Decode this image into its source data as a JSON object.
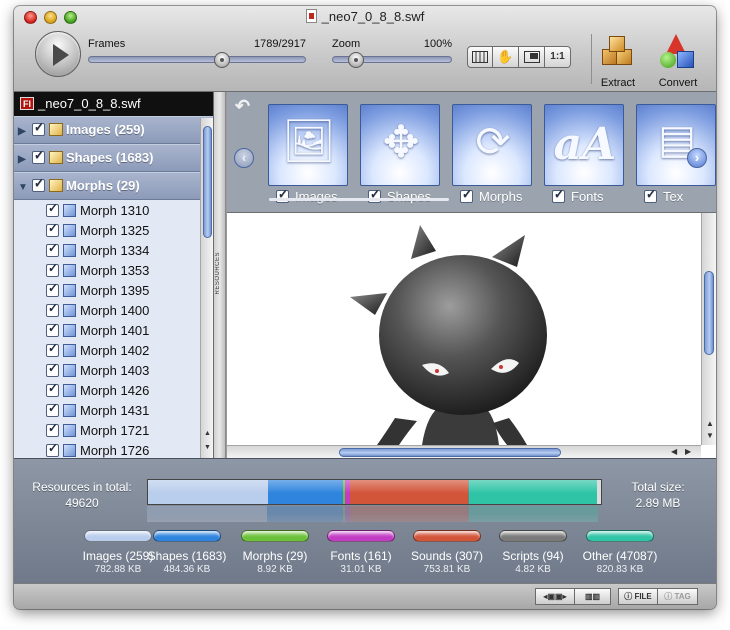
{
  "window": {
    "title": "_neo7_0_8_8.swf"
  },
  "toolbar": {
    "frames_label": "Frames",
    "frames_value": "1789/2917",
    "frames_position": 0.613,
    "zoom_label": "Zoom",
    "zoom_value": "100%",
    "zoom_position": 0.2,
    "view_buttons": [
      "grid",
      "hand",
      "fit",
      "1:1"
    ],
    "view_1to1_label": "1:1",
    "extract_label": "Extract",
    "convert_label": "Convert"
  },
  "tree": {
    "file_name": "_neo7_0_8_8.swf",
    "file_badge": "Fl",
    "groups": [
      {
        "label": "Images (259)",
        "expanded": false,
        "checked": true
      },
      {
        "label": "Shapes (1683)",
        "expanded": false,
        "checked": true
      },
      {
        "label": "Morphs (29)",
        "expanded": true,
        "checked": true
      }
    ],
    "items": [
      "Morph 1310",
      "Morph 1325",
      "Morph 1334",
      "Morph 1353",
      "Morph 1395",
      "Morph 1400",
      "Morph 1401",
      "Morph 1402",
      "Morph 1403",
      "Morph 1426",
      "Morph 1431",
      "Morph 1721",
      "Morph 1726"
    ],
    "splitter_label": "RESOURCES"
  },
  "resources": [
    {
      "label": "Images",
      "icon": "images-icon",
      "checked": true
    },
    {
      "label": "Shapes",
      "icon": "puzzle-icon",
      "checked": true
    },
    {
      "label": "Morphs",
      "icon": "morph-icon",
      "checked": true
    },
    {
      "label": "Fonts",
      "icon": "font-icon",
      "checked": true
    },
    {
      "label": "Tex",
      "icon": "text-icon",
      "checked": true
    }
  ],
  "stats": {
    "resources_label": "Resources in total:",
    "resources_value": "49620",
    "total_size_label": "Total size:",
    "total_size_value": "2.89 MB",
    "categories": [
      {
        "name": "Images (259)",
        "size": "782.88 KB",
        "color": "#b9cdec",
        "share": 0.264
      },
      {
        "name": "Shapes (1683)",
        "size": "484.36 KB",
        "color": "#2f84de",
        "share": 0.167
      },
      {
        "name": "Morphs (29)",
        "size": "8.92 KB",
        "color": "#6cc13a",
        "share": 0.004
      },
      {
        "name": "Fonts (161)",
        "size": "31.01 KB",
        "color": "#c23bc4",
        "share": 0.011
      },
      {
        "name": "Sounds (307)",
        "size": "753.81 KB",
        "color": "#d2553a",
        "share": 0.26
      },
      {
        "name": "Scripts (94)",
        "size": "4.82 KB",
        "color": "#7a7a7a",
        "share": 0.002
      },
      {
        "name": "Other (47087)",
        "size": "820.83 KB",
        "color": "#2fc4a6",
        "share": 0.284
      }
    ]
  },
  "statusbar": {
    "file_label": "FILE",
    "tag_label": "TAG"
  }
}
